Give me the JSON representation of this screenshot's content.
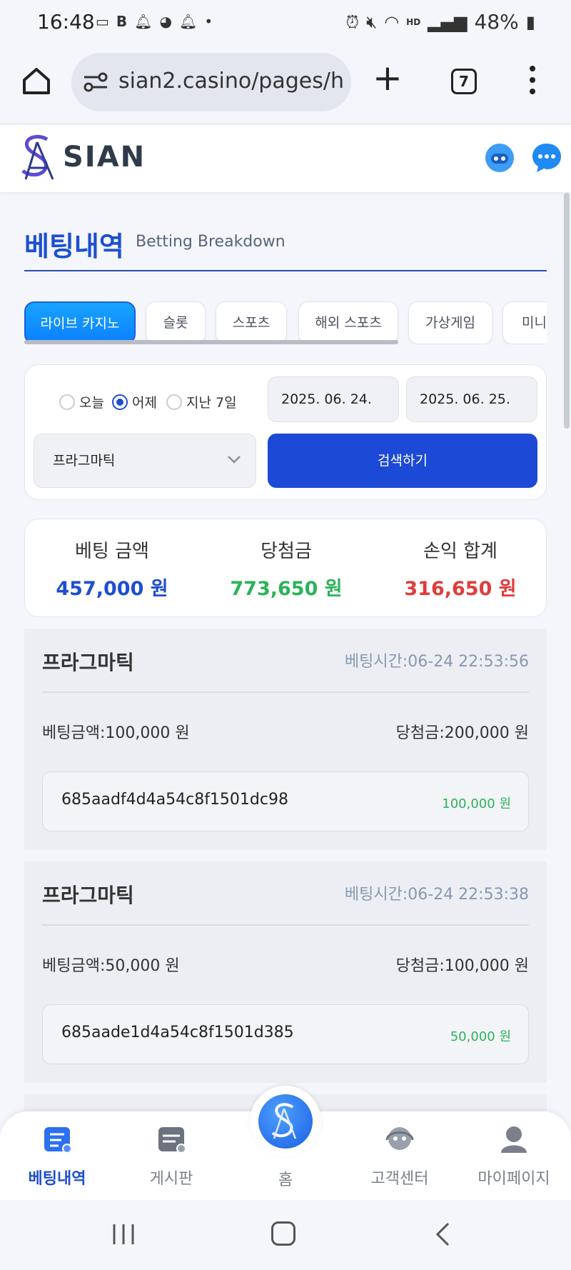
{
  "status_bar": {
    "time": "16:48",
    "battery": "48%"
  },
  "browser": {
    "url": "sian2.casino/pages/h",
    "tab_count": "7"
  },
  "site": {
    "logo_text": "SIAN"
  },
  "page": {
    "title_ko": "베팅내역",
    "title_en": "Betting Breakdown"
  },
  "category_tabs": [
    "라이브 카지노",
    "슬롯",
    "스포츠",
    "해외 스포츠",
    "가상게임",
    "미니게"
  ],
  "filter": {
    "ranges": [
      "오늘",
      "어제",
      "지난 7일"
    ],
    "selected_range": "어제",
    "date_from": "2025. 06. 24.",
    "date_to": "2025. 06. 25.",
    "provider": "프라그마틱",
    "search_label": "검색하기"
  },
  "summary": {
    "bet_label": "베팅 금액",
    "bet_value": "457,000 원",
    "win_label": "당첨금",
    "win_value": "773,650 원",
    "pl_label": "손익 합계",
    "pl_value": "316,650 원"
  },
  "records": [
    {
      "game": "프라그마틱",
      "time": "베팅시간:06-24 22:53:56",
      "bet": "베팅금액:100,000 원",
      "win": "당첨금:200,000 원",
      "id": "685aadf4d4a54c8f1501dc98",
      "amount": "100,000 원"
    },
    {
      "game": "프라그마틱",
      "time": "베팅시간:06-24 22:53:38",
      "bet": "베팅금액:50,000 원",
      "win": "당첨금:100,000 원",
      "id": "685aade1d4a54c8f1501d385",
      "amount": "50,000 원"
    }
  ],
  "bottom_nav": {
    "betting": "베팅내역",
    "board": "게시판",
    "home": "홈",
    "support": "고객센터",
    "mypage": "마이페이지"
  },
  "colors": {
    "brand_blue": "#1d4fd0",
    "win_green": "#2bb35a",
    "profit_red": "#e03c3c",
    "active_tab": "#0a7fff"
  }
}
